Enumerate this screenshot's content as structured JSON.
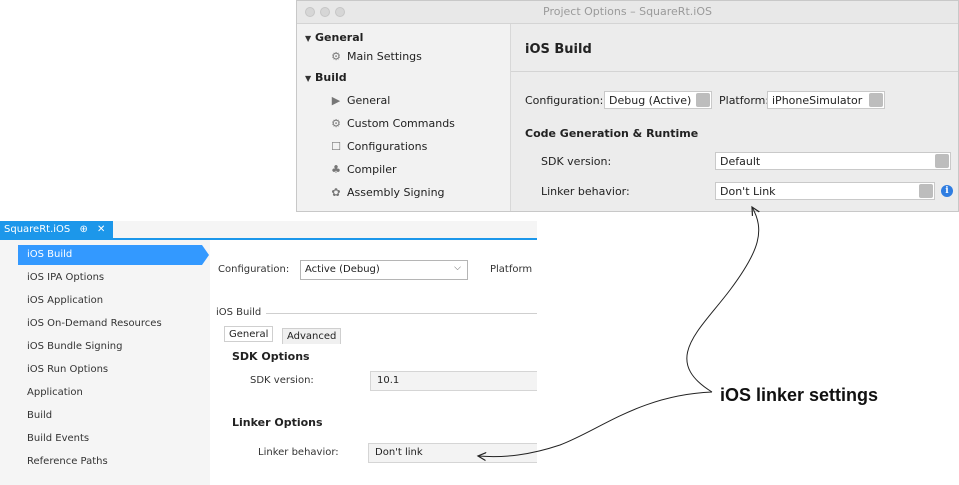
{
  "mac_window": {
    "title": "Project Options – SquareRt.iOS",
    "sidebar": {
      "general_header": "General",
      "main_settings": "Main Settings",
      "build_header": "Build",
      "items": [
        {
          "label": "General",
          "icon": "play-triangle-icon"
        },
        {
          "label": "Custom Commands",
          "icon": "gear-icon"
        },
        {
          "label": "Configurations",
          "icon": "window-icon"
        },
        {
          "label": "Compiler",
          "icon": "compiler-icon"
        },
        {
          "label": "Assembly Signing",
          "icon": "seal-icon"
        }
      ]
    },
    "main": {
      "heading": "iOS Build",
      "configuration_label": "Configuration:",
      "configuration_value": "Debug (Active)",
      "platform_label": "Platform:",
      "platform_value": "iPhoneSimulator",
      "section_title": "Code Generation & Runtime",
      "sdk_label": "SDK version:",
      "sdk_value": "Default",
      "linker_label": "Linker behavior:",
      "linker_value": "Don't Link"
    }
  },
  "vs_window": {
    "tab_title": "SquareRt.iOS",
    "tab_pin": "⊕",
    "tab_close": "✕",
    "nav_items": [
      "iOS Build",
      "iOS IPA Options",
      "iOS Application",
      "iOS On-Demand Resources",
      "iOS Bundle Signing",
      "iOS Run Options",
      "Application",
      "Build",
      "Build Events",
      "Reference Paths"
    ],
    "selected_index": 0,
    "configuration_label": "Configuration:",
    "configuration_value": "Active (Debug)",
    "platform_label": "Platform",
    "group_title": "iOS Build",
    "tabs": [
      "General",
      "Advanced"
    ],
    "sdk_section": "SDK Options",
    "sdk_label": "SDK version:",
    "sdk_value": "10.1",
    "linker_section": "Linker Options",
    "linker_label": "Linker behavior:",
    "linker_value": "Don't link"
  },
  "callout": {
    "text": "iOS linker settings"
  },
  "colors": {
    "vs_accent": "#1c97ea",
    "vs_selection": "#3399ff",
    "mac_info": "#2f7de1"
  }
}
